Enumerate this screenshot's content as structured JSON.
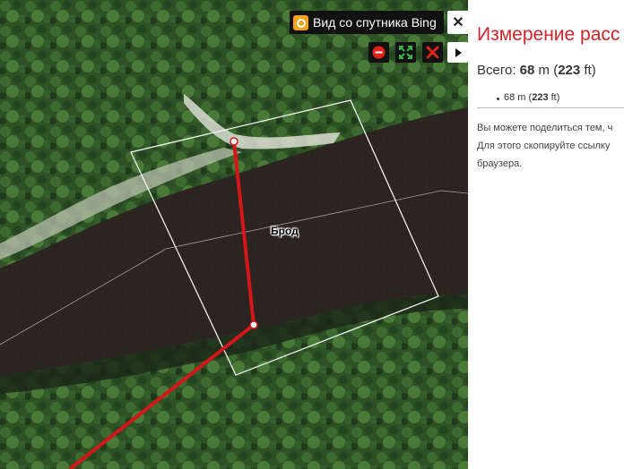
{
  "map": {
    "layer_label": "Вид со спутника Bing",
    "close_glyph": "✕",
    "tools": [
      {
        "icon": "minus-circle-icon",
        "color": "#e2231a"
      },
      {
        "icon": "expand-icon",
        "color": "#3bb54a"
      },
      {
        "icon": "delete-x-icon",
        "color": "#e2231a"
      }
    ],
    "collapse_icon": "triangle-right-icon",
    "feature_label": "Брод",
    "route_color": "#d4161a"
  },
  "panel": {
    "title": "Измерение расс",
    "total_prefix": "Всего: ",
    "total_m": "68",
    "total_unit_m": " m (",
    "total_ft": "223",
    "total_unit_ft": " ft)",
    "segment_m": "68",
    "segment_unit_m": " m (",
    "segment_ft": "223",
    "segment_unit_ft": " ft)",
    "note_lines": [
      "Вы можете поделиться тем, ч",
      "Для этого скопируйте ссылку",
      "браузера."
    ]
  }
}
